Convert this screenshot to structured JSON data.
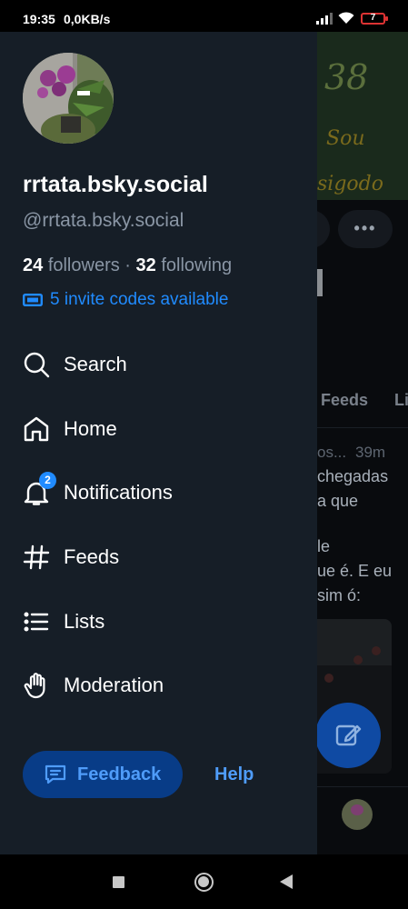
{
  "status_bar": {
    "time": "19:35",
    "network_speed": "0,0KB/s",
    "battery_level": "7",
    "battery_color": "#dd3333"
  },
  "drawer": {
    "display_name": "rrtata.bsky.social",
    "handle": "@rrtata.bsky.social",
    "followers_count": "24",
    "followers_label": "followers",
    "separator": "·",
    "following_count": "32",
    "following_label": "following",
    "invite_codes": "5 invite codes available",
    "nav_items": [
      {
        "label": "Search",
        "icon": "search-icon"
      },
      {
        "label": "Home",
        "icon": "home-icon"
      },
      {
        "label": "Notifications",
        "icon": "bell-icon",
        "badge": "2"
      },
      {
        "label": "Feeds",
        "icon": "hash-icon"
      },
      {
        "label": "Lists",
        "icon": "list-icon"
      },
      {
        "label": "Moderation",
        "icon": "hand-icon"
      }
    ],
    "feedback_label": "Feedback",
    "help_label": "Help",
    "accent_color": "#208bfe",
    "background_color": "#161e27"
  },
  "background_screen": {
    "banner_text_1": "38",
    "banner_text_2": "Sou",
    "banner_text_3": "sigodo",
    "more_button": "•••",
    "tabs": [
      "Feeds",
      "Li"
    ],
    "post_author": "os...",
    "post_time": "39m",
    "post_lines": [
      "chegadas",
      "a que",
      "",
      "le",
      "ue é. E eu",
      "sim ó:"
    ]
  }
}
